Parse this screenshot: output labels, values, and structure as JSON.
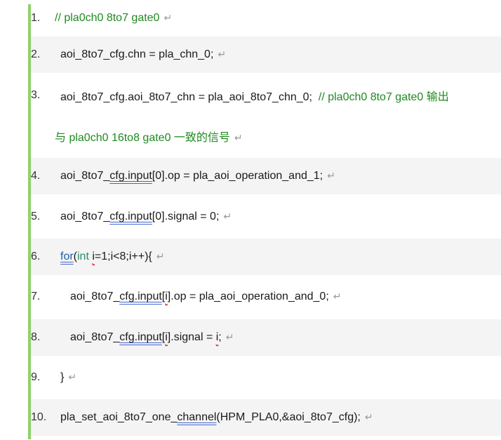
{
  "lines": [
    {
      "num": "1.",
      "comment": "// pla0ch0 8to7 gate0"
    },
    {
      "num": "2.",
      "text": "aoi_8to7_cfg.chn = pla_chn_0;"
    },
    {
      "num": "3.",
      "text": "aoi_8to7_cfg.aoi_8to7_chn = pla_aoi_8to7_chn_0;",
      "comment": "// pla0ch0 8to7 gate0 输出",
      "comment_cont": "与 pla0ch0 16to8 gate0 一致的信号"
    },
    {
      "num": "4.",
      "pre": "aoi_8to7_",
      "u1": "cfg.input",
      "post": "[0].op = pla_aoi_operation_and_1;"
    },
    {
      "num": "5.",
      "pre": "aoi_8to7_",
      "u1": "cfg.input",
      "post": "[0].signal = 0;"
    },
    {
      "num": "6.",
      "kw": "for",
      "paren": "(",
      "type": "int",
      "var": "i",
      "rest": "=1;i<8;i++){"
    },
    {
      "num": "7.",
      "pre": "aoi_8to7_",
      "u1": "cfg.input",
      "br1": "[",
      "var": "i",
      "post": "].op = pla_aoi_operation_and_0;"
    },
    {
      "num": "8.",
      "pre": "aoi_8to7_",
      "u1": "cfg.input",
      "br1": "[",
      "var": "i",
      "mid": "].signal = ",
      "var2": "i",
      "post": ";"
    },
    {
      "num": "9.",
      "text": "}"
    },
    {
      "num": "10.",
      "pre": "pla_set_aoi_8to7_one_",
      "u1": "channel",
      "post": "(HPM_PLA0,&aoi_8to7_cfg);"
    }
  ],
  "return_mark": "↵"
}
